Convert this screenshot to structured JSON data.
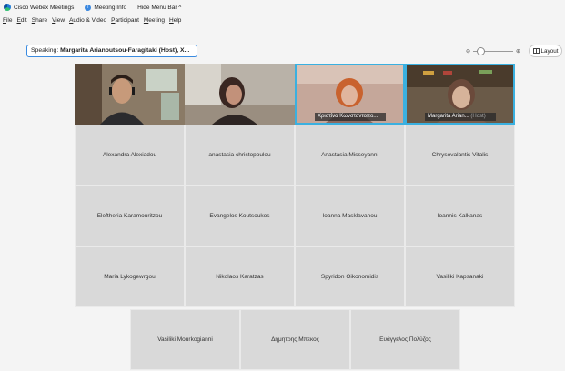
{
  "titlebar": {
    "app_name": "Cisco Webex Meetings",
    "meeting_info": "Meeting Info",
    "hide_menu": "Hide Menu Bar ^"
  },
  "menu": [
    "File",
    "Edit",
    "Share",
    "View",
    "Audio & Video",
    "Participant",
    "Meeting",
    "Help"
  ],
  "speaking": {
    "prefix": "Speaking:",
    "name": "Margarita Arianoutsou-Faragitaki (Host), X..."
  },
  "zoom": {
    "minus": "⊖",
    "plus": "⊕",
    "level": 0.15
  },
  "layout_label": "Layout",
  "video_tiles": [
    {
      "name": ""
    },
    {
      "name": ""
    },
    {
      "name": "Χριστίνα Κωνσταντοπο...",
      "host": ""
    },
    {
      "name": "Margarita Arian...",
      "host": "(Host)"
    }
  ],
  "participants_row1": [
    "Alexandra Alexiadou",
    "anastasia christopoulou",
    "Anastasia Misseyanni",
    "Chrysovalantis Vitalis"
  ],
  "participants_row2": [
    "Eleftheria Karamouritzou",
    "Evangelos Koutsoukos",
    "Ioanna Masklavanou",
    "Ioannis Kalkanas"
  ],
  "participants_row3": [
    "Maria Lykogewrgou",
    "Nikolaos Karatzas",
    "Spyridon Oikonomidis",
    "Vasiliki Kapsanaki"
  ],
  "participants_row4": [
    "Vasiliki Mourkogianni",
    "Δημητρης Μπεκος",
    "Ευάγγελος Πολύζος"
  ]
}
